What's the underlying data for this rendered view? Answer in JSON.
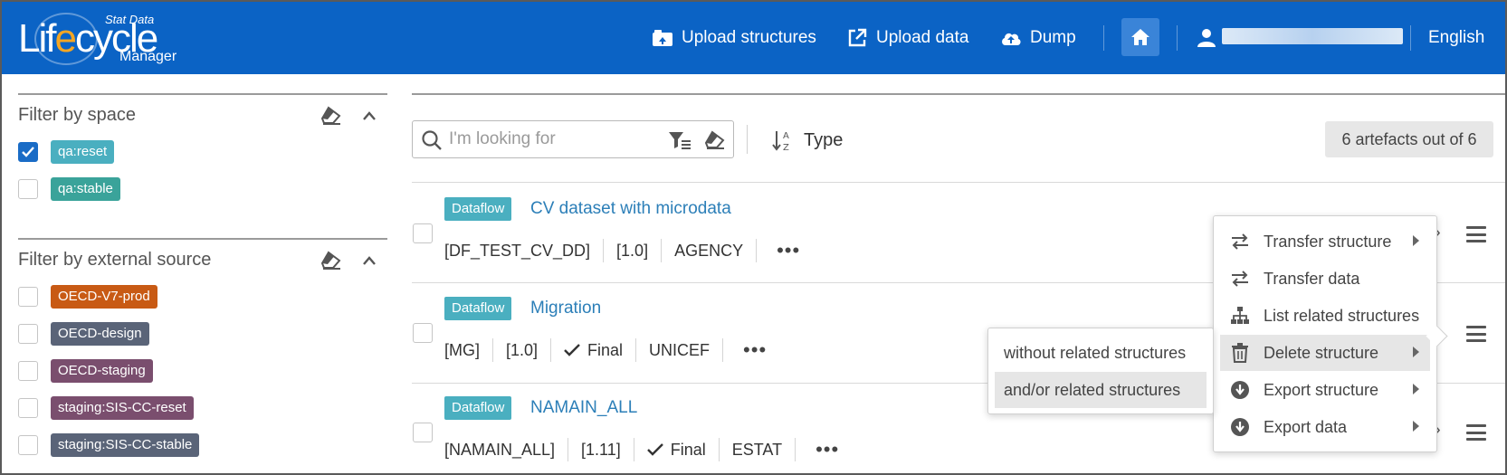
{
  "app": {
    "logo_stat": "Stat Data",
    "logo_main_pre": "Lif",
    "logo_main_e": "e",
    "logo_main_post": "cycle",
    "logo_sub": "Manager"
  },
  "header": {
    "upload_structures": "Upload structures",
    "upload_data": "Upload data",
    "dump": "Dump",
    "language": "English"
  },
  "sidebar": {
    "space_filter": {
      "title": "Filter by space",
      "items": [
        {
          "label": "qa:reset",
          "checked": true,
          "color": "#4aafc0"
        },
        {
          "label": "qa:stable",
          "checked": false,
          "color": "#3aa39a"
        }
      ]
    },
    "source_filter": {
      "title": "Filter by external source",
      "items": [
        {
          "label": "OECD-V7-prod",
          "color": "#c85a14"
        },
        {
          "label": "OECD-design",
          "color": "#5a6478"
        },
        {
          "label": "OECD-staging",
          "color": "#7a4e6e"
        },
        {
          "label": "staging:SIS-CC-reset",
          "color": "#7a4e6e"
        },
        {
          "label": "staging:SIS-CC-stable",
          "color": "#5a6478"
        }
      ]
    }
  },
  "toolbar": {
    "search_placeholder": "I'm looking for",
    "sort_label": "Type",
    "count": "6 artefacts out of 6"
  },
  "artefacts": [
    {
      "type": "Dataflow",
      "title": "CV dataset with microdata",
      "id": "[DF_TEST_CV_DD]",
      "version": "[1.0]",
      "final": "",
      "agency": "AGENCY"
    },
    {
      "type": "Dataflow",
      "title": "Migration",
      "id": "[MG]",
      "version": "[1.0]",
      "final": "Final",
      "agency": "UNICEF"
    },
    {
      "type": "Dataflow",
      "title": "NAMAIN_ALL",
      "id": "[NAMAIN_ALL]",
      "version": "[1.11]",
      "final": "Final",
      "agency": "ESTAT"
    }
  ],
  "context_menu": {
    "items": [
      {
        "label": "Transfer structure",
        "icon": "transfer-icon",
        "submenu": true
      },
      {
        "label": "Transfer data",
        "icon": "transfer-icon",
        "submenu": false
      },
      {
        "label": "List related structures",
        "icon": "sitemap-icon",
        "submenu": false
      },
      {
        "label": "Delete structure",
        "icon": "trash-icon",
        "submenu": true
      },
      {
        "label": "Export structure",
        "icon": "download-icon",
        "submenu": true
      },
      {
        "label": "Export data",
        "icon": "download-icon",
        "submenu": true
      }
    ],
    "delete_submenu": [
      {
        "label": "without related structures"
      },
      {
        "label": "and/or related structures"
      }
    ]
  },
  "colors": {
    "header": "#0b63c5",
    "accent": "#1a6cc6",
    "type_badge": "#4aafc0",
    "link": "#2c7fb8"
  }
}
